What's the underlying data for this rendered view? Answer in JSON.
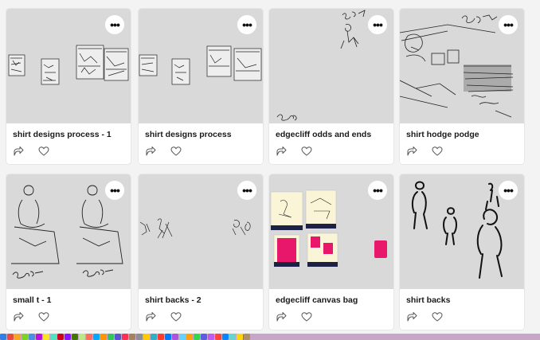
{
  "cards": [
    {
      "title": "shirt designs process - 1",
      "more_label": "•••",
      "show_more": true
    },
    {
      "title": "shirt designs process",
      "more_label": "•••",
      "show_more": true
    },
    {
      "title": "edgecliff odds and ends",
      "more_label": "•••",
      "show_more": true
    },
    {
      "title": "shirt hodge podge",
      "more_label": "•••",
      "show_more": true
    },
    {
      "title": "small t - 1",
      "more_label": "•••",
      "show_more": true
    },
    {
      "title": "shirt backs - 2",
      "more_label": "•••",
      "show_more": true
    },
    {
      "title": "edgecliff canvas bag",
      "more_label": "•••",
      "show_more": true
    },
    {
      "title": "shirt backs",
      "more_label": "•••",
      "show_more": true
    }
  ],
  "colors": {
    "card_bg": "#ffffff",
    "thumb_bg": "#d9d9d9",
    "page_bg": "#f3f3f3",
    "accent_pink": "#e8176b",
    "navy": "#1c2145"
  },
  "icons": {
    "share": "share-arrow-icon",
    "like": "heart-icon",
    "more": "more-dots-icon"
  },
  "dock": {
    "app_colors": [
      "#2f7fe6",
      "#e84b3c",
      "#f5a623",
      "#7ed321",
      "#4a90e2",
      "#bd10e0",
      "#f8e71c",
      "#50e3c2",
      "#d0021b",
      "#9013fe",
      "#417505",
      "#b8e986",
      "#ff6f61",
      "#00aaff",
      "#ff9500",
      "#34c759",
      "#5856d6",
      "#ff2d55",
      "#a2845e",
      "#8e8e93",
      "#ffcc00",
      "#30b0c7",
      "#ff3b30",
      "#007aff",
      "#af52de",
      "#64d2ff",
      "#ff9f0a",
      "#32d74b",
      "#5e5ce6",
      "#bf5af2",
      "#ff453a",
      "#0a84ff",
      "#66d4cf",
      "#ffd60a",
      "#ac8e68"
    ]
  }
}
